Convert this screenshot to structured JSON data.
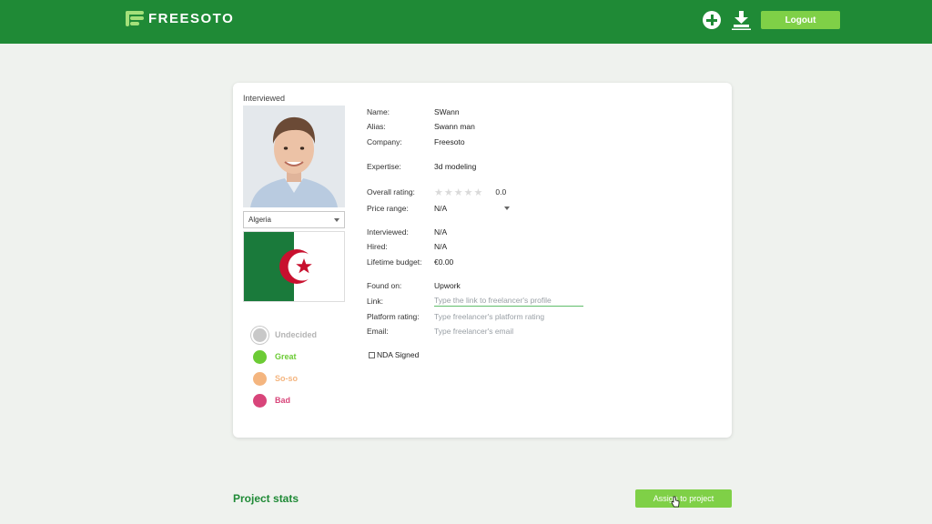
{
  "header": {
    "logo_text": "FREESOTO",
    "logout_label": "Logout",
    "colors": {
      "bar": "#1f8a36",
      "accent": "#7fd047"
    }
  },
  "profile": {
    "interviewed_label": "Interviewed",
    "country": "Algeria",
    "statuses": [
      {
        "label": "Undecided",
        "color": "#c8c8c8"
      },
      {
        "label": "Great",
        "color": "#6ccb35"
      },
      {
        "label": "So-so",
        "color": "#f4b57f"
      },
      {
        "label": "Bad",
        "color": "#d8457a"
      }
    ]
  },
  "details": {
    "name_label": "Name:",
    "name": "SWann",
    "alias_label": "Alias:",
    "alias": "Swann man",
    "company_label": "Company:",
    "company": "Freesoto",
    "expertise_label": "Expertise:",
    "expertise": "3d modeling",
    "rating_label": "Overall rating:",
    "rating_value": "0.0",
    "rating_stars": 0,
    "price_label": "Price range:",
    "price_value": "N/A",
    "interviewed_label": "Interviewed:",
    "interviewed": "N/A",
    "hired_label": "Hired:",
    "hired": "N/A",
    "budget_label": "Lifetime budget:",
    "budget": "€0.00",
    "found_label": "Found on:",
    "found": "Upwork",
    "link_label": "Link:",
    "link_placeholder": "Type the link to freelancer's profile",
    "platform_rating_label": "Platform rating:",
    "platform_rating_placeholder": "Type freelancer's platform rating",
    "email_label": "Email:",
    "email_placeholder": "Type freelancer's email",
    "nda_label": "NDA Signed"
  },
  "footer": {
    "project_stats": "Project stats",
    "assign_label": "Assign to project"
  }
}
